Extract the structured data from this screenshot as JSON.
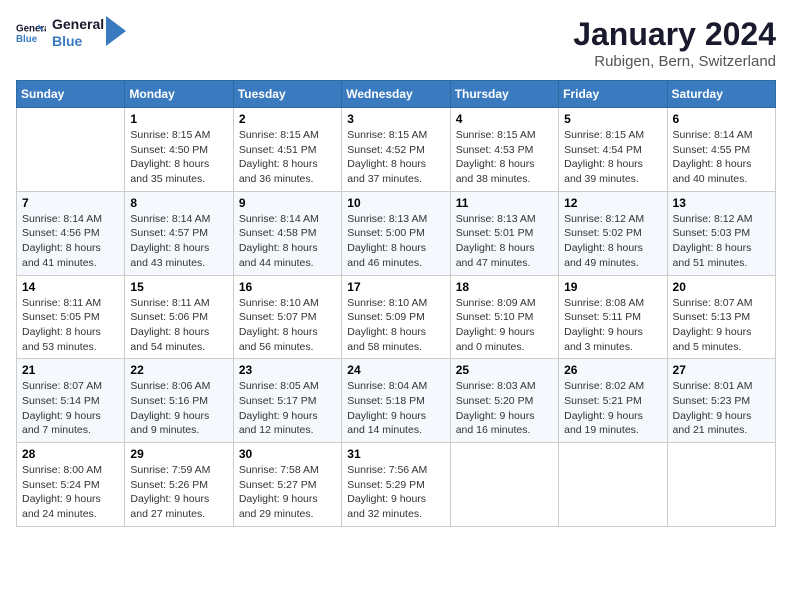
{
  "logo": {
    "line1": "General",
    "line2": "Blue"
  },
  "title": "January 2024",
  "subtitle": "Rubigen, Bern, Switzerland",
  "days_of_week": [
    "Sunday",
    "Monday",
    "Tuesday",
    "Wednesday",
    "Thursday",
    "Friday",
    "Saturday"
  ],
  "weeks": [
    [
      {
        "day": "",
        "info": ""
      },
      {
        "day": "1",
        "info": "Sunrise: 8:15 AM\nSunset: 4:50 PM\nDaylight: 8 hours\nand 35 minutes."
      },
      {
        "day": "2",
        "info": "Sunrise: 8:15 AM\nSunset: 4:51 PM\nDaylight: 8 hours\nand 36 minutes."
      },
      {
        "day": "3",
        "info": "Sunrise: 8:15 AM\nSunset: 4:52 PM\nDaylight: 8 hours\nand 37 minutes."
      },
      {
        "day": "4",
        "info": "Sunrise: 8:15 AM\nSunset: 4:53 PM\nDaylight: 8 hours\nand 38 minutes."
      },
      {
        "day": "5",
        "info": "Sunrise: 8:15 AM\nSunset: 4:54 PM\nDaylight: 8 hours\nand 39 minutes."
      },
      {
        "day": "6",
        "info": "Sunrise: 8:14 AM\nSunset: 4:55 PM\nDaylight: 8 hours\nand 40 minutes."
      }
    ],
    [
      {
        "day": "7",
        "info": "Sunrise: 8:14 AM\nSunset: 4:56 PM\nDaylight: 8 hours\nand 41 minutes."
      },
      {
        "day": "8",
        "info": "Sunrise: 8:14 AM\nSunset: 4:57 PM\nDaylight: 8 hours\nand 43 minutes."
      },
      {
        "day": "9",
        "info": "Sunrise: 8:14 AM\nSunset: 4:58 PM\nDaylight: 8 hours\nand 44 minutes."
      },
      {
        "day": "10",
        "info": "Sunrise: 8:13 AM\nSunset: 5:00 PM\nDaylight: 8 hours\nand 46 minutes."
      },
      {
        "day": "11",
        "info": "Sunrise: 8:13 AM\nSunset: 5:01 PM\nDaylight: 8 hours\nand 47 minutes."
      },
      {
        "day": "12",
        "info": "Sunrise: 8:12 AM\nSunset: 5:02 PM\nDaylight: 8 hours\nand 49 minutes."
      },
      {
        "day": "13",
        "info": "Sunrise: 8:12 AM\nSunset: 5:03 PM\nDaylight: 8 hours\nand 51 minutes."
      }
    ],
    [
      {
        "day": "14",
        "info": "Sunrise: 8:11 AM\nSunset: 5:05 PM\nDaylight: 8 hours\nand 53 minutes."
      },
      {
        "day": "15",
        "info": "Sunrise: 8:11 AM\nSunset: 5:06 PM\nDaylight: 8 hours\nand 54 minutes."
      },
      {
        "day": "16",
        "info": "Sunrise: 8:10 AM\nSunset: 5:07 PM\nDaylight: 8 hours\nand 56 minutes."
      },
      {
        "day": "17",
        "info": "Sunrise: 8:10 AM\nSunset: 5:09 PM\nDaylight: 8 hours\nand 58 minutes."
      },
      {
        "day": "18",
        "info": "Sunrise: 8:09 AM\nSunset: 5:10 PM\nDaylight: 9 hours\nand 0 minutes."
      },
      {
        "day": "19",
        "info": "Sunrise: 8:08 AM\nSunset: 5:11 PM\nDaylight: 9 hours\nand 3 minutes."
      },
      {
        "day": "20",
        "info": "Sunrise: 8:07 AM\nSunset: 5:13 PM\nDaylight: 9 hours\nand 5 minutes."
      }
    ],
    [
      {
        "day": "21",
        "info": "Sunrise: 8:07 AM\nSunset: 5:14 PM\nDaylight: 9 hours\nand 7 minutes."
      },
      {
        "day": "22",
        "info": "Sunrise: 8:06 AM\nSunset: 5:16 PM\nDaylight: 9 hours\nand 9 minutes."
      },
      {
        "day": "23",
        "info": "Sunrise: 8:05 AM\nSunset: 5:17 PM\nDaylight: 9 hours\nand 12 minutes."
      },
      {
        "day": "24",
        "info": "Sunrise: 8:04 AM\nSunset: 5:18 PM\nDaylight: 9 hours\nand 14 minutes."
      },
      {
        "day": "25",
        "info": "Sunrise: 8:03 AM\nSunset: 5:20 PM\nDaylight: 9 hours\nand 16 minutes."
      },
      {
        "day": "26",
        "info": "Sunrise: 8:02 AM\nSunset: 5:21 PM\nDaylight: 9 hours\nand 19 minutes."
      },
      {
        "day": "27",
        "info": "Sunrise: 8:01 AM\nSunset: 5:23 PM\nDaylight: 9 hours\nand 21 minutes."
      }
    ],
    [
      {
        "day": "28",
        "info": "Sunrise: 8:00 AM\nSunset: 5:24 PM\nDaylight: 9 hours\nand 24 minutes."
      },
      {
        "day": "29",
        "info": "Sunrise: 7:59 AM\nSunset: 5:26 PM\nDaylight: 9 hours\nand 27 minutes."
      },
      {
        "day": "30",
        "info": "Sunrise: 7:58 AM\nSunset: 5:27 PM\nDaylight: 9 hours\nand 29 minutes."
      },
      {
        "day": "31",
        "info": "Sunrise: 7:56 AM\nSunset: 5:29 PM\nDaylight: 9 hours\nand 32 minutes."
      },
      {
        "day": "",
        "info": ""
      },
      {
        "day": "",
        "info": ""
      },
      {
        "day": "",
        "info": ""
      }
    ]
  ]
}
